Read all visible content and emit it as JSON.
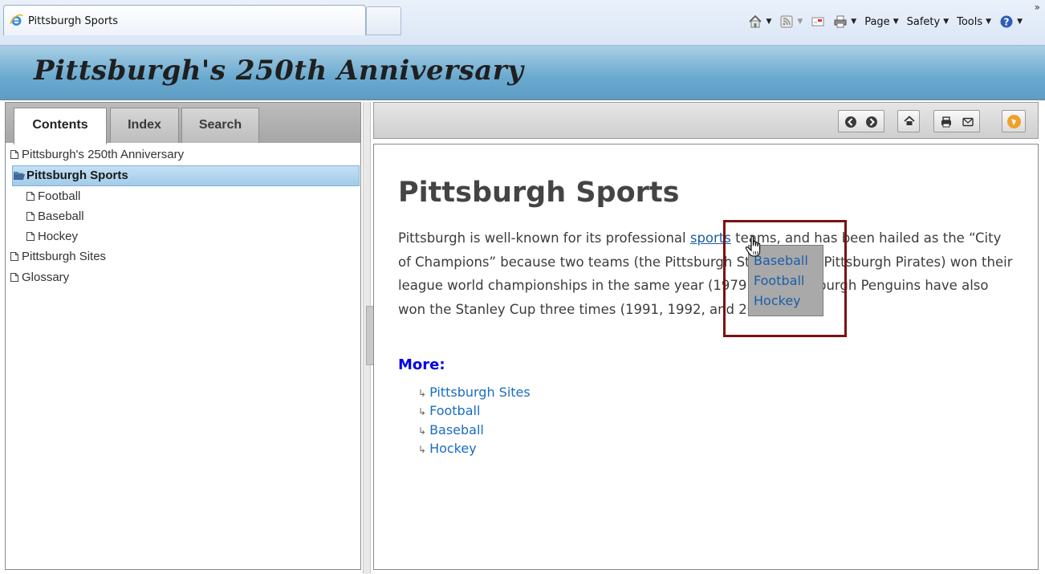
{
  "browser": {
    "tab_title": "Pittsburgh Sports",
    "commands": {
      "page": "Page",
      "safety": "Safety",
      "tools": "Tools"
    },
    "chevron": "»"
  },
  "banner": {
    "title": "Pittsburgh's 250th Anniversary"
  },
  "nav_tabs": [
    "Contents",
    "Index",
    "Search"
  ],
  "toc": [
    {
      "label": "Pittsburgh's 250th Anniversary",
      "level": 0
    },
    {
      "label": "Pittsburgh Sports",
      "level": 0,
      "selected": true
    },
    {
      "label": "Football",
      "level": 1
    },
    {
      "label": "Baseball",
      "level": 1
    },
    {
      "label": "Hockey",
      "level": 1
    },
    {
      "label": "Pittsburgh Sites",
      "level": 0
    },
    {
      "label": "Glossary",
      "level": 0
    }
  ],
  "content": {
    "title": "Pittsburgh Sports",
    "para_before_link": "Pittsburgh is well-known for its professional ",
    "link_text": "sports",
    "para_after_link": " teams, and has been hailed as the “City of Champions” because two teams (the Pittsburgh Steelers and Pittsburgh Pirates) won their league world championships in the same year (1979).  The Pittsburgh Penguins have also won the Stanley Cup three times (1991, 1992, and 2009).",
    "more_heading": "More:",
    "more_links": [
      "Pittsburgh Sites",
      "Football",
      "Baseball",
      "Hockey"
    ]
  },
  "popup": {
    "items": [
      "Baseball",
      "Football",
      "Hockey"
    ]
  },
  "colors": {
    "banner": "#6aa9cf",
    "link": "#1a5fa8",
    "highlight_border": "#7e1010",
    "more_heading": "#0000ee"
  }
}
